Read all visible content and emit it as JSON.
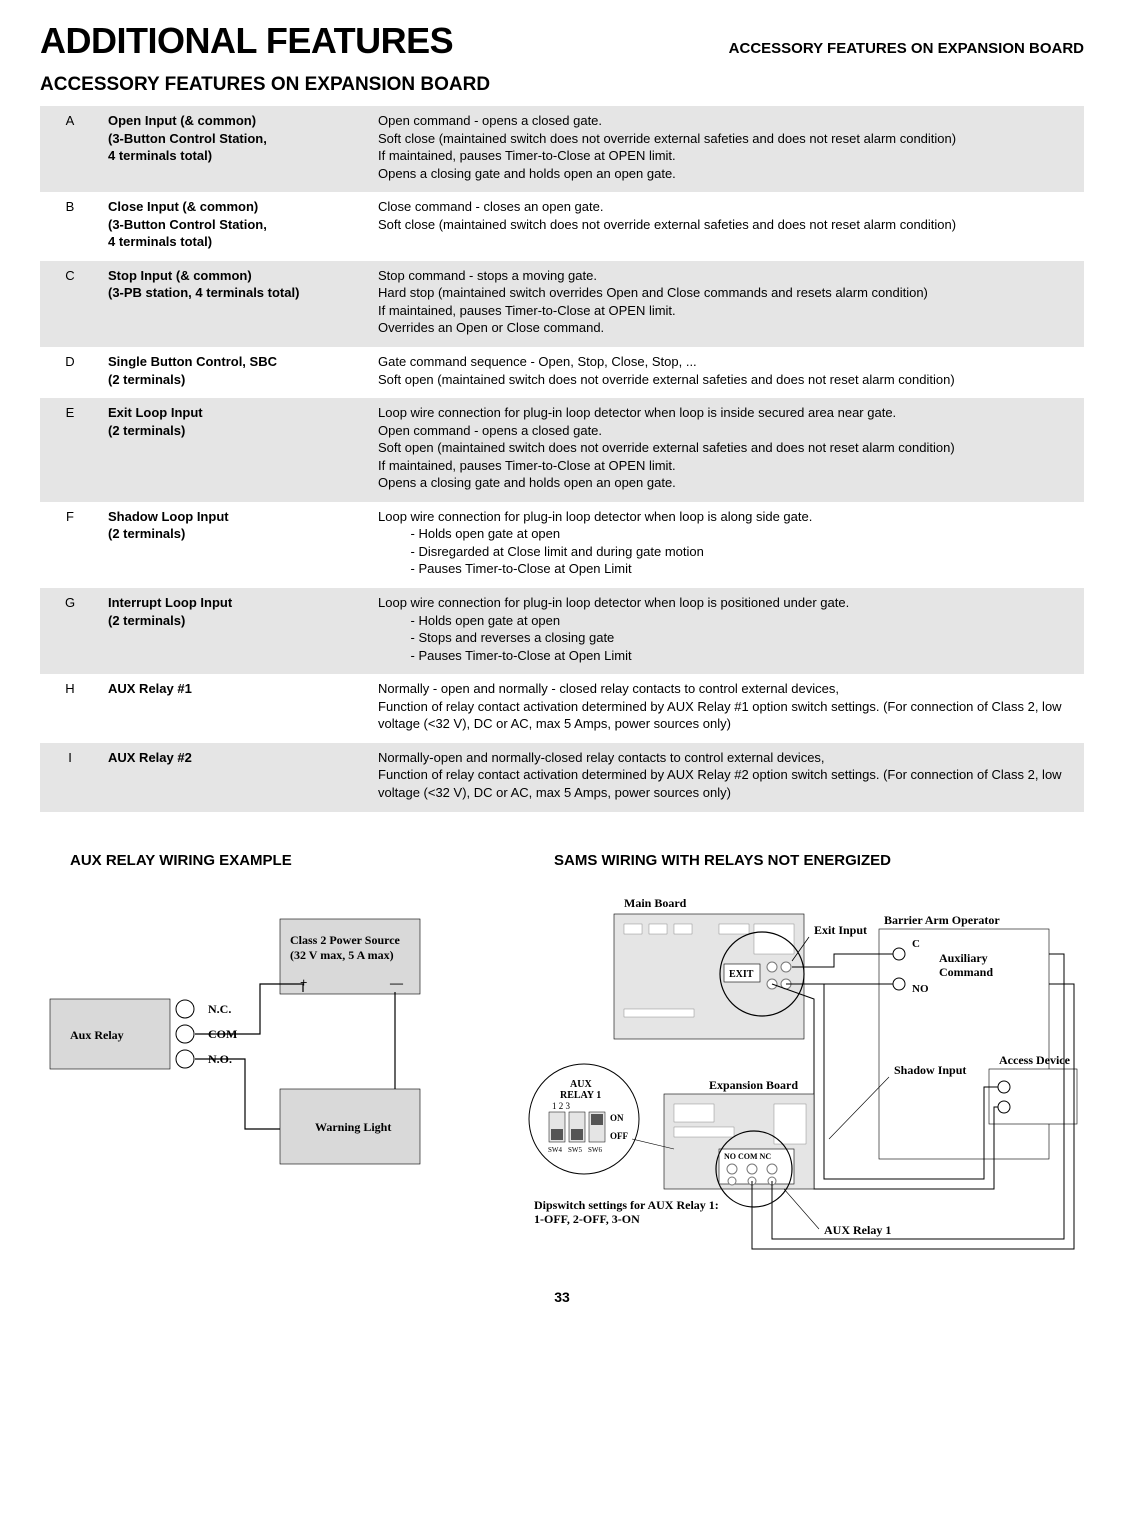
{
  "header": {
    "main_title": "ADDITIONAL FEATURES",
    "right_title": "ACCESSORY FEATURES ON EXPANSION BOARD",
    "section_title": "ACCESSORY FEATURES ON EXPANSION BOARD"
  },
  "rows": [
    {
      "letter": "A",
      "name": "Open Input (& common)\n(3-Button Control Station,\n4 terminals total)",
      "desc": "Open command - opens a closed gate.\nSoft close (maintained switch does not override external safeties and does not reset alarm condition)\nIf maintained, pauses Timer-to-Close at OPEN limit.\nOpens a closing gate and holds open an open gate."
    },
    {
      "letter": "B",
      "name": "Close Input (& common)\n(3-Button Control Station,\n4 terminals total)",
      "desc": "Close command - closes an open gate.\nSoft close (maintained switch does not override external safeties and does not reset alarm condition)"
    },
    {
      "letter": "C",
      "name": "Stop Input (& common)\n(3-PB station, 4 terminals total)",
      "desc": "Stop command - stops a moving gate.\nHard stop (maintained switch overrides Open and Close commands and resets alarm condition)\nIf maintained, pauses Timer-to-Close at OPEN limit.\nOverrides an Open or Close command."
    },
    {
      "letter": "D",
      "name": "Single Button Control, SBC\n(2 terminals)",
      "desc": "Gate command sequence - Open, Stop, Close, Stop, ...\nSoft open (maintained switch does not override external safeties and does not reset alarm condition)"
    },
    {
      "letter": "E",
      "name": "Exit Loop Input\n(2 terminals)",
      "desc": "Loop wire connection for plug-in loop detector when loop is inside secured area near gate.\nOpen command - opens a closed gate.\nSoft open (maintained switch does not override external safeties and does not reset alarm condition)\nIf maintained, pauses Timer-to-Close at OPEN limit.\nOpens a closing gate and holds open an open gate."
    },
    {
      "letter": "F",
      "name": "Shadow Loop Input\n(2 terminals)",
      "desc": "Loop wire connection for plug-in loop detector when loop is along side gate.\n         - Holds open gate at open\n         - Disregarded at Close limit and during gate motion\n         - Pauses Timer-to-Close at Open Limit"
    },
    {
      "letter": "G",
      "name": "Interrupt Loop Input\n(2 terminals)",
      "desc": "Loop wire connection for plug-in loop detector when loop is positioned under gate.\n         - Holds open gate at open\n         - Stops and reverses a closing gate\n         - Pauses Timer-to-Close at Open Limit"
    },
    {
      "letter": "H",
      "name": "AUX Relay #1",
      "desc": "Normally - open and normally - closed relay contacts to control external devices,\nFunction of relay contact activation determined by AUX Relay #1 option switch settings. (For connection of Class 2, low voltage (<32 V), DC or AC, max 5 Amps, power sources only)"
    },
    {
      "letter": "I",
      "name": "AUX Relay #2",
      "desc": "Normally-open and normally-closed relay contacts to control external devices,\nFunction of relay contact activation determined by AUX Relay #2 option switch settings. (For connection of Class 2, low voltage (<32 V), DC or AC, max 5 Amps, power sources only)"
    }
  ],
  "diagram_left": {
    "title": "AUX RELAY WIRING EXAMPLE",
    "aux_relay": "Aux Relay",
    "nc": "N.C.",
    "com": "COM",
    "no": "N.O.",
    "class2": "Class 2 Power Source\n(32 V max, 5 A max)",
    "plus": "+",
    "minus": "—",
    "warning": "Warning Light"
  },
  "diagram_right": {
    "title": "SAMS WIRING WITH RELAYS NOT ENERGIZED",
    "main_board": "Main Board",
    "exit_input": "Exit Input",
    "barrier": "Barrier Arm Operator",
    "c": "C",
    "no": "NO",
    "aux_cmd": "Auxiliary\nCommand",
    "access_device": "Access Device",
    "expansion_board": "Expansion Board",
    "shadow_input": "Shadow Input",
    "aux_relay_1_box": "AUX\nRELAY 1",
    "sw_nums": "1     2     3",
    "on": "ON",
    "off": "OFF",
    "sw4": "SW4",
    "sw5": "SW5",
    "sw6": "SW6",
    "dip_note": "Dipswitch settings for AUX Relay 1:\n1-OFF, 2-OFF, 3-ON",
    "aux_relay_1": "AUX Relay 1",
    "exit_tag": "EXIT",
    "term_labels": "NO   COM   NC"
  },
  "page_number": "33"
}
